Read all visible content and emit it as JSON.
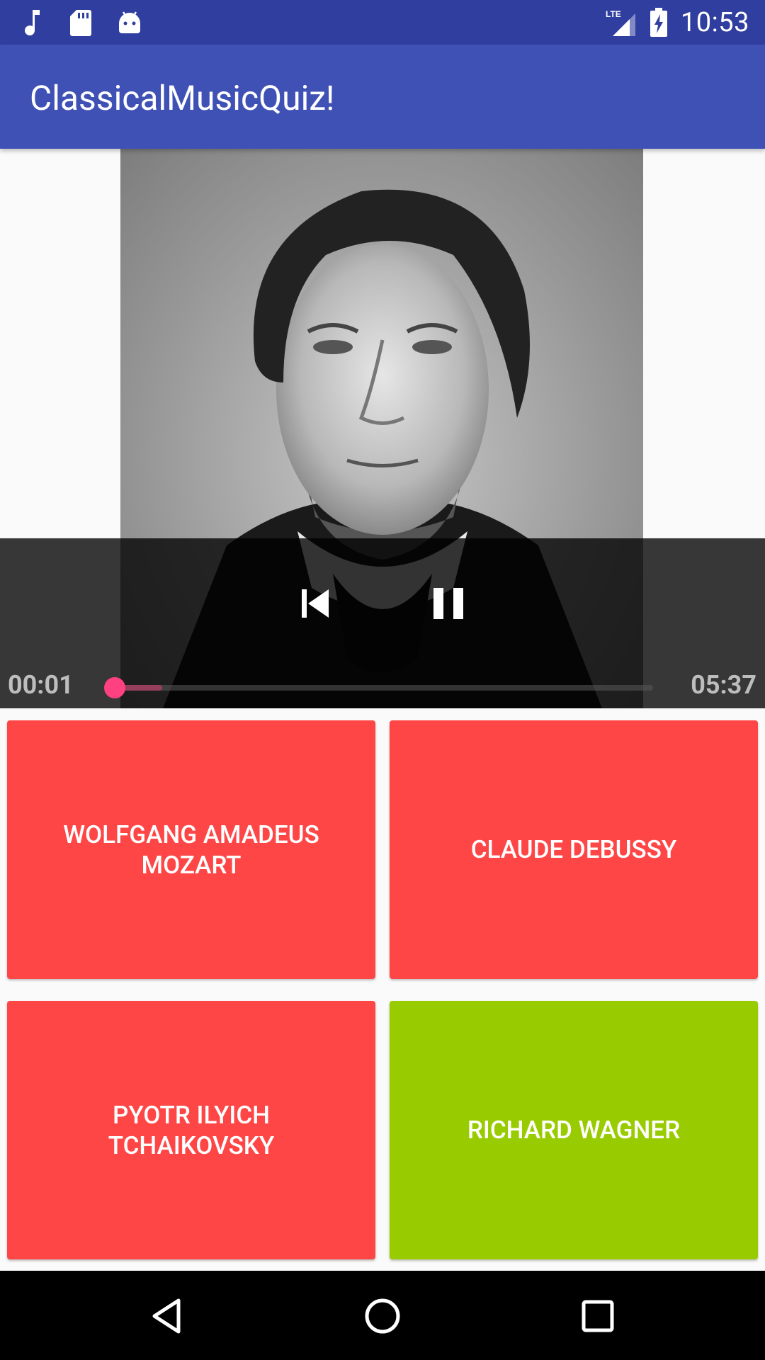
{
  "status_bar": {
    "time": "10:53",
    "network": "LTE",
    "left_icons": [
      "music-note-icon",
      "sd-card-icon",
      "android-icon"
    ],
    "color": "#303f9f"
  },
  "app_bar": {
    "title": "ClassicalMusicQuiz!",
    "color": "#3f51b5"
  },
  "player": {
    "elapsed": "00:01",
    "duration": "05:37",
    "progress_fraction": 0.003,
    "buffered_fraction": 0.09,
    "accent_color": "#ff4081",
    "buttons": [
      "skip-previous-icon",
      "pause-icon"
    ]
  },
  "answers": [
    {
      "label": "WOLFGANG AMADEUS MOZART",
      "color": "#ff4646"
    },
    {
      "label": "CLAUDE DEBUSSY",
      "color": "#ff4646"
    },
    {
      "label": "PYOTR ILYICH TCHAIKOVSKY",
      "color": "#ff4646"
    },
    {
      "label": "RICHARD WAGNER",
      "color": "#99cc00"
    }
  ],
  "nav_bar": {
    "buttons": [
      "back-icon",
      "home-icon",
      "recents-icon"
    ]
  }
}
